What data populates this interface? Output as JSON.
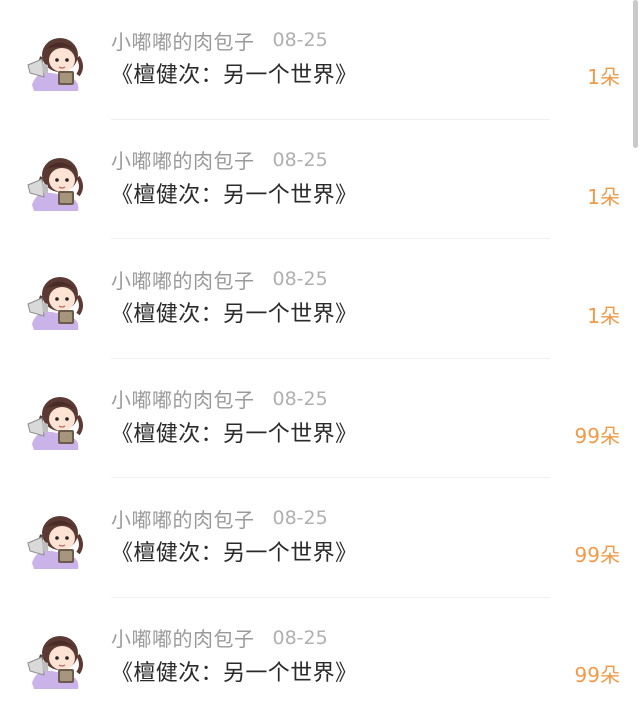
{
  "gift_records": [
    {
      "username": "小嘟嘟的肉包子",
      "date": "08-25",
      "message": "《檀健次：另一个世界》",
      "count": "1朵"
    },
    {
      "username": "小嘟嘟的肉包子",
      "date": "08-25",
      "message": "《檀健次：另一个世界》",
      "count": "1朵"
    },
    {
      "username": "小嘟嘟的肉包子",
      "date": "08-25",
      "message": "《檀健次：另一个世界》",
      "count": "1朵"
    },
    {
      "username": "小嘟嘟的肉包子",
      "date": "08-25",
      "message": "《檀健次：另一个世界》",
      "count": "99朵"
    },
    {
      "username": "小嘟嘟的肉包子",
      "date": "08-25",
      "message": "《檀健次：另一个世界》",
      "count": "99朵"
    },
    {
      "username": "小嘟嘟的肉包子",
      "date": "08-25",
      "message": "《檀健次：另一个世界》",
      "count": "99朵"
    }
  ],
  "colors": {
    "count_accent": "#f09a47",
    "username": "#9a9a9a",
    "message": "#2a2a2a"
  },
  "icons": {
    "avatar": "cartoon-girl-avatar-icon"
  }
}
